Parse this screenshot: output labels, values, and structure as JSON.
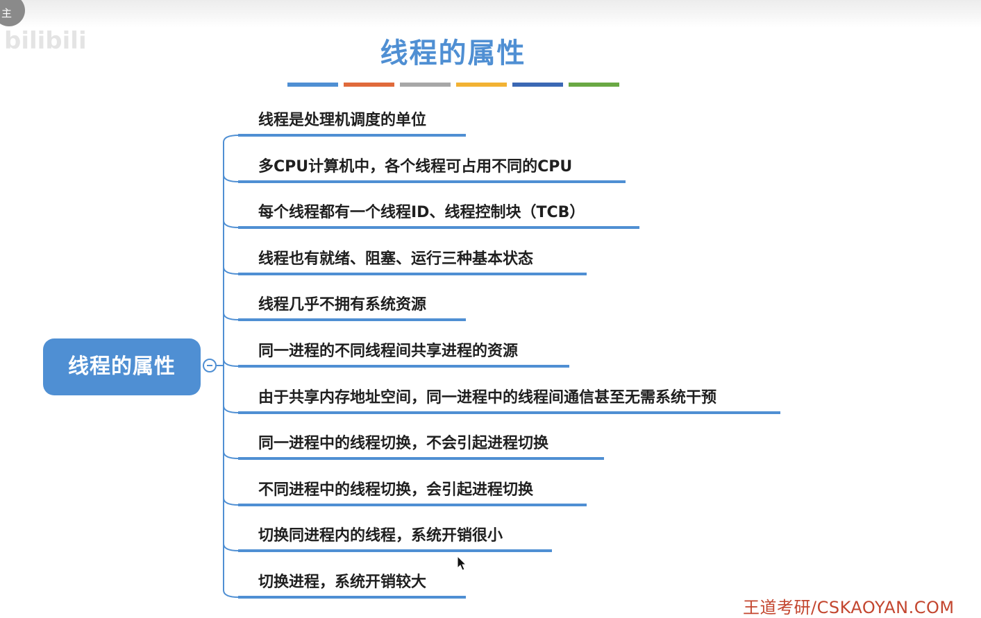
{
  "overlay": {
    "avatar_text": "主",
    "logo_text": "bilibili"
  },
  "title": "线程的属性",
  "title_bar_colors": [
    "#4f8fd3",
    "#e06a3b",
    "#a7a7a7",
    "#f2b233",
    "#3b68b4",
    "#6aa844"
  ],
  "mindmap": {
    "root": "线程的属性",
    "accent_color": "#4f8fd3",
    "branches": [
      "线程是处理机调度的单位",
      "多CPU计算机中，各个线程可占用不同的CPU",
      "每个线程都有一个线程ID、线程控制块（TCB）",
      "线程也有就绪、阻塞、运行三种基本状态",
      "线程几乎不拥有系统资源",
      "同一进程的不同线程间共享进程的资源",
      "由于共享内存地址空间，同一进程中的线程间通信甚至无需系统干预",
      "同一进程中的线程切换，不会引起进程切换",
      "不同进程中的线程切换，会引起进程切换",
      "切换同进程内的线程，系统开销很小",
      "切换进程，系统开销较大"
    ]
  },
  "footer": "王道考研/CSKAOYAN.COM"
}
